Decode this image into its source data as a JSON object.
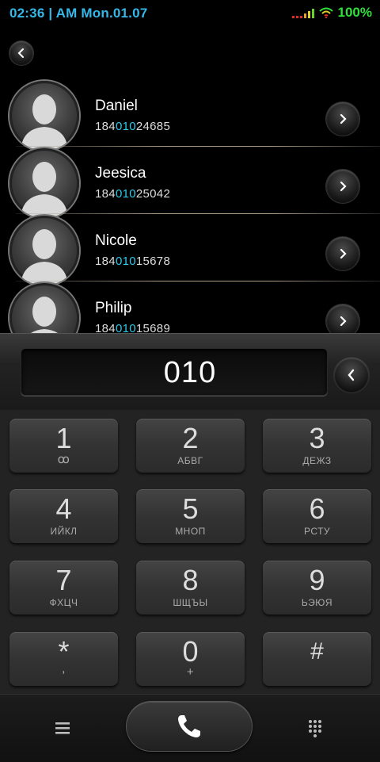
{
  "status_bar": {
    "time": "02:36 | AM Mon.01.07",
    "battery": "100%"
  },
  "contacts": [
    {
      "name": "Daniel",
      "number_pre": "184",
      "number_match": "010",
      "number_post": "24685"
    },
    {
      "name": "Jeesica",
      "number_pre": "184",
      "number_match": "010",
      "number_post": "25042"
    },
    {
      "name": "Nicole",
      "number_pre": "184",
      "number_match": "010",
      "number_post": "15678"
    },
    {
      "name": "Philip",
      "number_pre": "184",
      "number_match": "010",
      "number_post": "15689"
    }
  ],
  "dialer": {
    "entered_number": "010"
  },
  "keypad": [
    {
      "digit": "1",
      "letters": "ꝏ"
    },
    {
      "digit": "2",
      "letters": "АБВГ"
    },
    {
      "digit": "3",
      "letters": "ДЕЖЗ"
    },
    {
      "digit": "4",
      "letters": "ИЙКЛ"
    },
    {
      "digit": "5",
      "letters": "МНОП"
    },
    {
      "digit": "6",
      "letters": "РСТУ"
    },
    {
      "digit": "7",
      "letters": "ФХЦЧ"
    },
    {
      "digit": "8",
      "letters": "ШЩЪЫ"
    },
    {
      "digit": "9",
      "letters": "ЬЭЮЯ"
    },
    {
      "digit": "*",
      "letters": ","
    },
    {
      "digit": "0",
      "letters": "+"
    },
    {
      "digit": "#",
      "letters": ""
    }
  ],
  "colors": {
    "accent": "#35b7e8",
    "match_highlight": "#2fc8e8",
    "battery": "#2fe03a"
  }
}
